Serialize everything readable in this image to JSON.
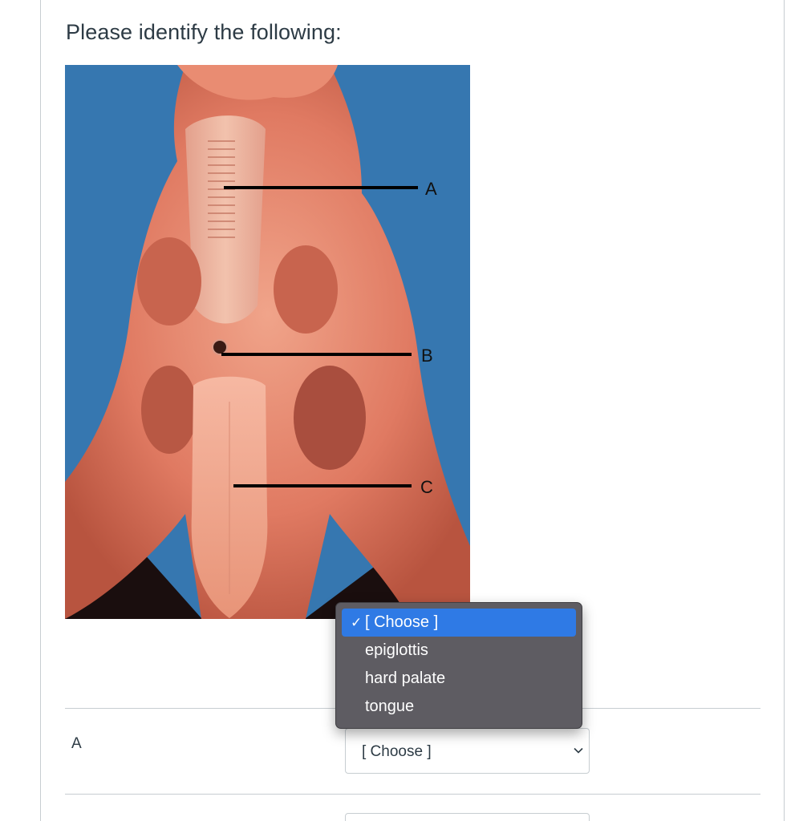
{
  "question": {
    "prompt": "Please identify the following:",
    "image_labels": [
      "A",
      "B",
      "C"
    ]
  },
  "answers": [
    {
      "label": "A",
      "select_value": "[ Choose ]"
    }
  ],
  "dropdown": {
    "options": [
      {
        "label": "[ Choose ]",
        "selected": true
      },
      {
        "label": "epiglottis",
        "selected": false
      },
      {
        "label": "hard palate",
        "selected": false
      },
      {
        "label": "tongue",
        "selected": false
      }
    ],
    "check_glyph": "✓"
  },
  "colors": {
    "image_background": "#3677b0",
    "highlight": "#2f7ae5",
    "menu_background": "#5e5c62"
  }
}
